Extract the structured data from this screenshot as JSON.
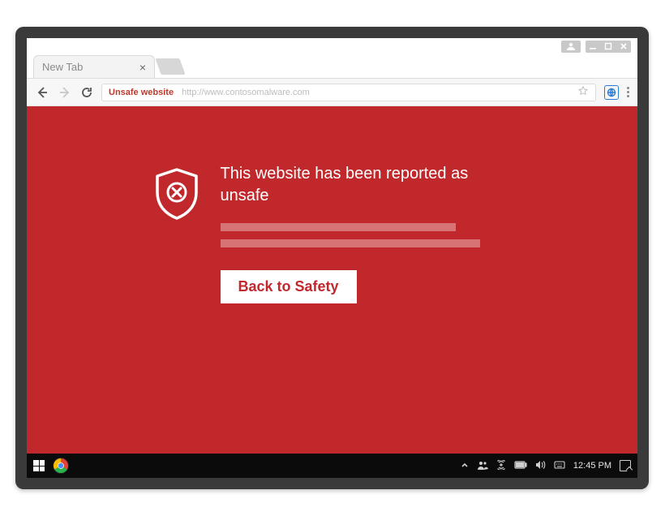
{
  "tab": {
    "title": "New Tab"
  },
  "addressbar": {
    "warning_label": "Unsafe website",
    "url": "http://www.contosomalware.com"
  },
  "warning": {
    "heading": "This website has been reported as unsafe",
    "button_label": "Back to Safety"
  },
  "taskbar": {
    "clock": "12:45 PM"
  }
}
